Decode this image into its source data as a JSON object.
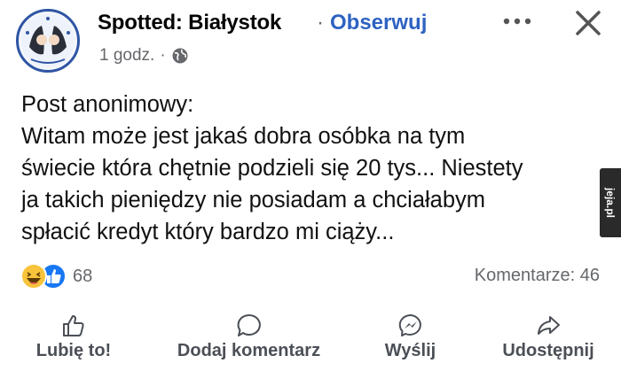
{
  "header": {
    "page_name": "Spotted: Białystok",
    "separator": "·",
    "follow_label": "Obserwuj",
    "time": "1 godz.",
    "time_separator": "·",
    "privacy_icon": "globe-icon",
    "more_icon": "more-dots-icon",
    "close_icon": "close-icon"
  },
  "post": {
    "lines": [
      "Post anonimowy:",
      "Witam może jest jakaś dobra osóbka na tym",
      "świecie która chętnie podzieli się 20 tys... Niestety",
      "ja takich pieniędzy nie posiadam a chciałabym",
      "spłacić kredyt który bardzo mi ciąży..."
    ]
  },
  "reactions": {
    "icons": [
      "haha-icon",
      "like-icon"
    ],
    "count": "68",
    "comments": "Komentarze: 46"
  },
  "actions": [
    {
      "label": "Lubię to!",
      "icon": "thumbs-up-icon"
    },
    {
      "label": "Dodaj komentarz",
      "icon": "comment-icon"
    },
    {
      "label": "Wyślij",
      "icon": "messenger-icon"
    },
    {
      "label": "Udostępnij",
      "icon": "share-icon"
    }
  ],
  "watermark": "jeja.pl",
  "colors": {
    "follow": "#2e62c2",
    "secondary_text": "#65676b",
    "like_blue": "#1877f2",
    "haha_yellow": "#f7c43b"
  }
}
